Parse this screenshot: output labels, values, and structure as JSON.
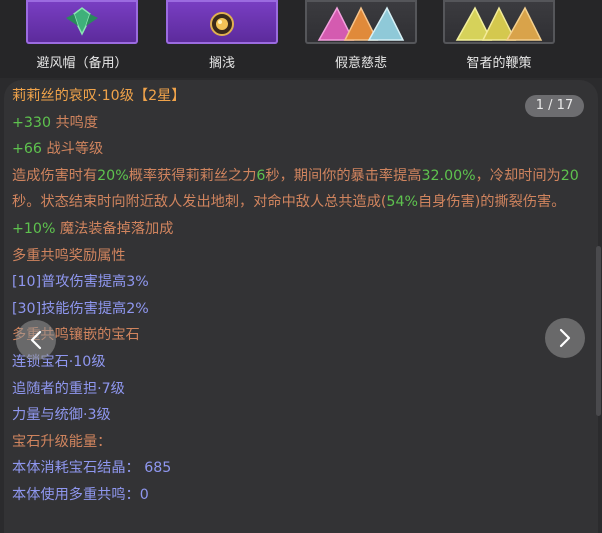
{
  "icon_strip": {
    "items": [
      {
        "label": "避风帽（备用）",
        "icon": "purple-gem-helmet-icon"
      },
      {
        "label": "搁浅",
        "icon": "golden-orb-icon"
      },
      {
        "label": "假意慈悲",
        "icon": "triple-triangle-gems-icon"
      },
      {
        "label": "智者的鞭策",
        "icon": "triple-yellow-triangle-gems-icon"
      }
    ]
  },
  "tooltip": {
    "counter": "1 / 17",
    "title": "莉莉丝的哀叹·10级",
    "stars": "【2星】",
    "stat1_value": "+330",
    "stat1_label": " 共鸣度",
    "stat2_value": "+66",
    "stat2_label": " 战斗等级",
    "desc": {
      "p1": "造成伤害时有",
      "v1": "20%",
      "p2": "概率获得莉莉丝之力",
      "v2": "6",
      "p3": "秒，期间你的暴击率提高",
      "v3": "32.00%",
      "p4": "，冷却时间为",
      "v4": "20",
      "p5": "秒。状态结束时向附近敌人发出地刺，对命中敌人总共造成(",
      "v5": "54%",
      "p6": "自身伤害)的撕裂伤害。"
    },
    "stat3_value": "+10%",
    "stat3_label": " 魔法装备掉落加成",
    "multi_bonus_title": "多重共鸣奖励属性",
    "multi_bonus": [
      "[10]普攻伤害提高3%",
      "[30]技能伤害提高2%"
    ],
    "socket_title": "多重共鸣镶嵌的宝石",
    "gems": [
      "连锁宝石·10级",
      "追随者的重担·7级",
      "力量与统御·3级"
    ],
    "upgrade_title": "宝石升级能量：",
    "upgrade_lines": [
      "本体消耗宝石结晶： 685",
      "本体使用多重共鸣：0"
    ]
  },
  "colors": {
    "orange": "#f0a34a",
    "green": "#5ec24e",
    "brown": "#d0845e",
    "blue": "#8f97ef",
    "panel_bg": "#333335"
  }
}
